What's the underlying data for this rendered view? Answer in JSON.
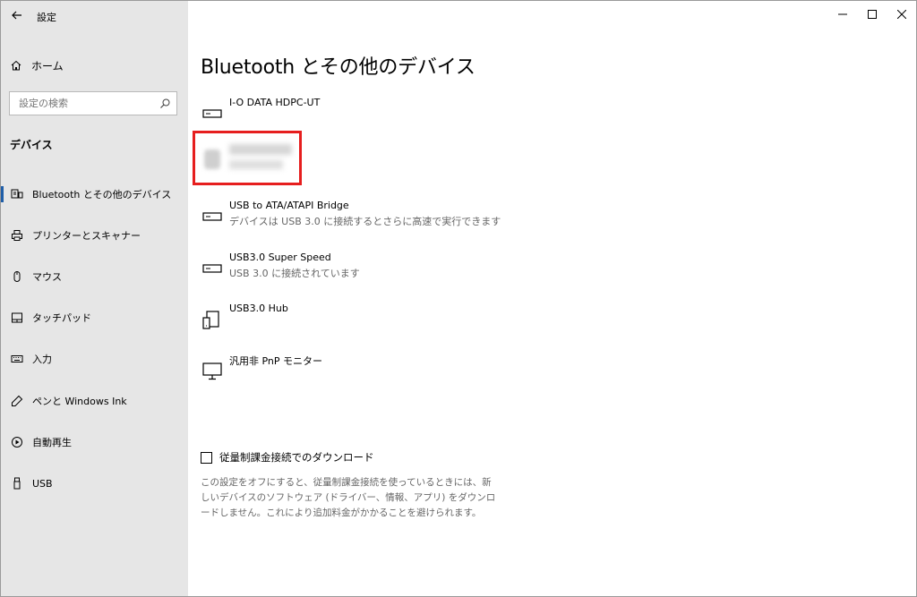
{
  "window": {
    "title": "設定"
  },
  "sidebar": {
    "home_label": "ホーム",
    "search_placeholder": "設定の検索",
    "section_title": "デバイス",
    "items": [
      {
        "label": "Bluetooth とその他のデバイス",
        "icon": "bluetooth-devices-icon",
        "active": true
      },
      {
        "label": "プリンターとスキャナー",
        "icon": "printer-icon"
      },
      {
        "label": "マウス",
        "icon": "mouse-icon"
      },
      {
        "label": "タッチパッド",
        "icon": "touchpad-icon"
      },
      {
        "label": "入力",
        "icon": "keyboard-icon"
      },
      {
        "label": "ペンと Windows Ink",
        "icon": "pen-icon"
      },
      {
        "label": "自動再生",
        "icon": "autoplay-icon"
      },
      {
        "label": "USB",
        "icon": "usb-icon"
      }
    ]
  },
  "main": {
    "title": "Bluetooth とその他のデバイス",
    "devices": [
      {
        "name": "I-O DATA HDPC-UT",
        "status": "",
        "icon": "drive-icon"
      },
      {
        "name": "USB to ATA/ATAPI Bridge",
        "status": "デバイスは USB 3.0 に接続するとさらに高速で実行できます",
        "icon": "drive-icon"
      },
      {
        "name": "USB3.0  Super Speed",
        "status": "USB 3.0 に接続されています",
        "icon": "drive-icon"
      },
      {
        "name": "USB3.0 Hub",
        "status": "",
        "icon": "devices-icon"
      },
      {
        "name": "汎用非 PnP モニター",
        "status": "",
        "icon": "monitor-icon"
      }
    ],
    "metered": {
      "label": "従量制課金接続でのダウンロード",
      "checked": false,
      "description": "この設定をオフにすると、従量制課金接続を使っているときには、新しいデバイスのソフトウェア (ドライバー、情報、アプリ) をダウンロードしません。これにより追加料金がかかることを避けられます。"
    }
  },
  "colors": {
    "sidebar_bg": "#e6e6e6",
    "accent": "#1f5ea8",
    "highlight_box": "#e61e1e"
  }
}
